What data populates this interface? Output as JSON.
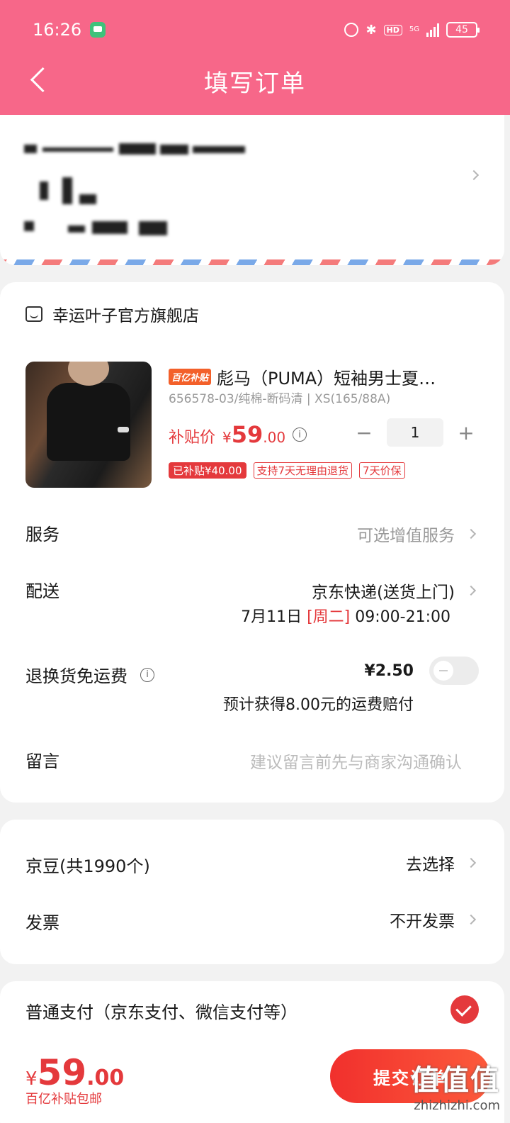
{
  "status_bar": {
    "time": "16:26",
    "network": "5G",
    "hd": "HD",
    "battery": "45"
  },
  "nav": {
    "title": "填写订单"
  },
  "store": {
    "name": "幸运叶子官方旗舰店"
  },
  "product": {
    "badge": "百亿补贴",
    "title": "彪马（PUMA）短袖男士夏…",
    "spec": "656578-03/纯棉-断码清 | XS(165/88A)",
    "price_label": "补贴价",
    "currency": "¥",
    "price_int": "59",
    "price_dec": ".00",
    "quantity": "1",
    "minus": "−",
    "plus": "+",
    "tags": [
      "已补贴¥40.00",
      "支持7天无理由退货",
      "7天价保"
    ]
  },
  "rows": {
    "service_label": "服务",
    "service_value": "可选增值服务",
    "delivery_label": "配送",
    "delivery_value": "京东快递(送货上门)",
    "delivery_date": "7月11日",
    "delivery_week": "[周二]",
    "delivery_time": "09:00-21:00",
    "return_label": "退换货免运费",
    "return_price": "¥2.50",
    "return_note": "预计获得8.00元的运费赔付",
    "message_label": "留言",
    "message_placeholder": "建议留言前先与商家沟通确认"
  },
  "extras": {
    "beans_label": "京豆(共1990个)",
    "beans_value": "去选择",
    "invoice_label": "发票",
    "invoice_value": "不开发票"
  },
  "payment": {
    "method": "普通支付（京东支付、微信支付等）",
    "total_currency": "¥",
    "total_int": "59",
    "total_dec": ".00",
    "total_note": "百亿补贴包邮",
    "submit": "提交订单"
  },
  "watermark": {
    "text": "值值值",
    "site": "zhizhizhi.com"
  },
  "colors": {
    "header": "#f76789",
    "accent": "#e4393c"
  }
}
